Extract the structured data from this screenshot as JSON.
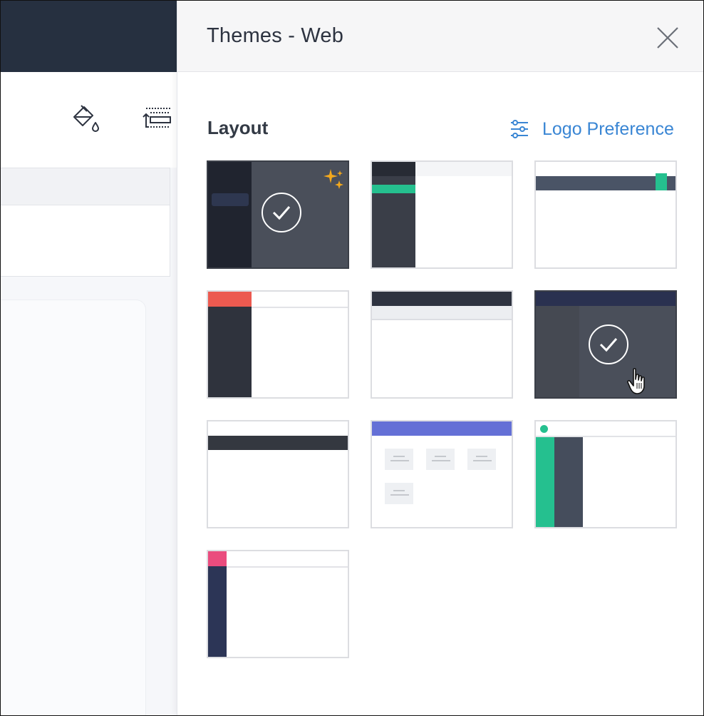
{
  "panel": {
    "title": "Themes - Web",
    "close_icon": "close-icon",
    "section_title": "Layout",
    "logo_preference_label": "Logo Preference",
    "logo_preference_icon": "sliders-icon"
  },
  "toolbar_icons": [
    "paint-bucket-icon",
    "layout-list-icon"
  ],
  "themes": [
    {
      "id": "theme-1",
      "selected": true,
      "badge_icon": "sparkles-icon"
    },
    {
      "id": "theme-2",
      "selected": false
    },
    {
      "id": "theme-3",
      "selected": false
    },
    {
      "id": "theme-4",
      "selected": false
    },
    {
      "id": "theme-5",
      "selected": false
    },
    {
      "id": "theme-6",
      "selected": true
    },
    {
      "id": "theme-7",
      "selected": false
    },
    {
      "id": "theme-8",
      "selected": false
    },
    {
      "id": "theme-9",
      "selected": false
    },
    {
      "id": "theme-10",
      "selected": false
    }
  ],
  "colors": {
    "accent_link": "#3a86d4",
    "dark_navy": "#263040",
    "green": "#25c08f",
    "red": "#ec5a50",
    "purple": "#6470d6",
    "pink": "#ea4c7e",
    "gold_sparkle": "#f2a81d"
  }
}
